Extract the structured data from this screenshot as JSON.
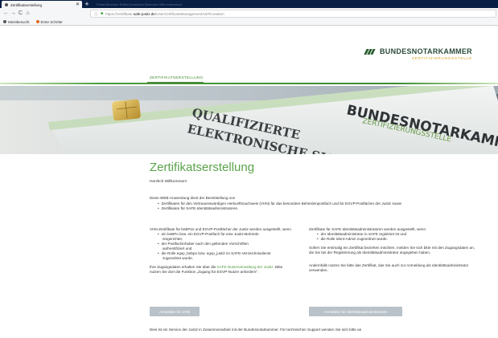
{
  "browser": {
    "tab_title": "Zertifikatserstellung",
    "tab_close": "✕",
    "new_tab": "+",
    "tabbar_faint": "Portal   Benutzer   Rollen   Anmelden   Beenden   Hilfe   Impressum",
    "url_host": "https://zertifikate.",
    "url_domain": "safe-justiz.de",
    "url_path": "/UserCertificateManagement/UI/#/creation",
    "back": "←",
    "forward": "→",
    "reload": "C",
    "home": "⌂",
    "bookmarks": [
      "Meistbesucht",
      "Erste Schritte"
    ]
  },
  "header": {
    "logo_title": "BUNDESNOTARKAMMER",
    "logo_sub": "ZERTIFIZIERUNGSSTELLE",
    "nav_item": "ZERTIFIKATSERSTELLUNG"
  },
  "hero": {
    "line1": "QUALIFIZIERTE",
    "line2": "ELEKTRONISCHE SIG",
    "line3": "BUNDESNOTARKAMMER",
    "line4": "ZERTIFIZIERUNGSSTELLE"
  },
  "content": {
    "title": "Zertifikatserstellung",
    "welcome": "Herzlich Willkommen!",
    "intro": "Diese WEB-Anwendung dient der Bereitstellung von",
    "intro_items": [
      "Zertifikaten für den Vertrauenswürdigen Herkunftsnachweis (VHN) für das besondere Behördenpostfach und für EGVP-Postfächer der Justiz sowie",
      "Zertifikaten für SAFE-Identitätsadministratoren."
    ],
    "left": {
      "p1": "VHN-Zertifikate für beBPos und EGVP-Postfächer der Justiz werden ausgestellt, wenn",
      "items": [
        [
          "ein beBPo bzw. ein EGVP-Postfach für eine Justiz-Behörde",
          "eingerichtet,"
        ],
        [
          "der Postfachinhaber nach den geltenden Vorschriften",
          "authentifiziert und"
        ],
        [
          "die Rolle egvp_bebpo bzw. egvp_justiz im SAFE-Verzeichnisdienst",
          "zugeordnet wurde."
        ]
      ],
      "p2_a": "Ihre Zugangsdaten erhalten Sie über die ",
      "p2_link": "SAFE Nutzerverwaltung der",
      "p2_b": "Justiz",
      "p2_c": ". Bitte nutzen Sie dort die Funktion „Zugang für EGVP-Nutzer",
      "p2_d": "anfordern\"."
    },
    "right": {
      "p1": "Zertifikate für SAFE-Identitätsadministratoren werden ausgestellt, wenn",
      "items": [
        "der Identitätsadministrator in SAFE registriert ist und",
        "die Rolle Ident-Admin zugeordnet wurde."
      ],
      "p2": "Sofern Sie erstmalig ein Zertifikat beziehen möchten, melden Sie sich bitte mit den Zugangsdaten an, die Sie bei der Registrierung als Identitätsadministrator angegeben haben.",
      "p3": "Andernfalls nutzen Sie bitte das Zertifikat, das Sie auch zur Anmeldung als Identitätsadministrator verwenden."
    },
    "btn_vhn": "Anmelden für VHN",
    "btn_admin": "Anmelden für Identitätsadministratoren",
    "footer": "Dies ist ein Service der Justiz in Zusammenarbeit mit der Bundesnotarkammer. Für technischen Support wenden Sie sich bitte an"
  },
  "colors": {
    "accent_green": "#5aa34a",
    "button_grey": "#b9c2c8",
    "tabbar_navy": "#0a1f44"
  }
}
